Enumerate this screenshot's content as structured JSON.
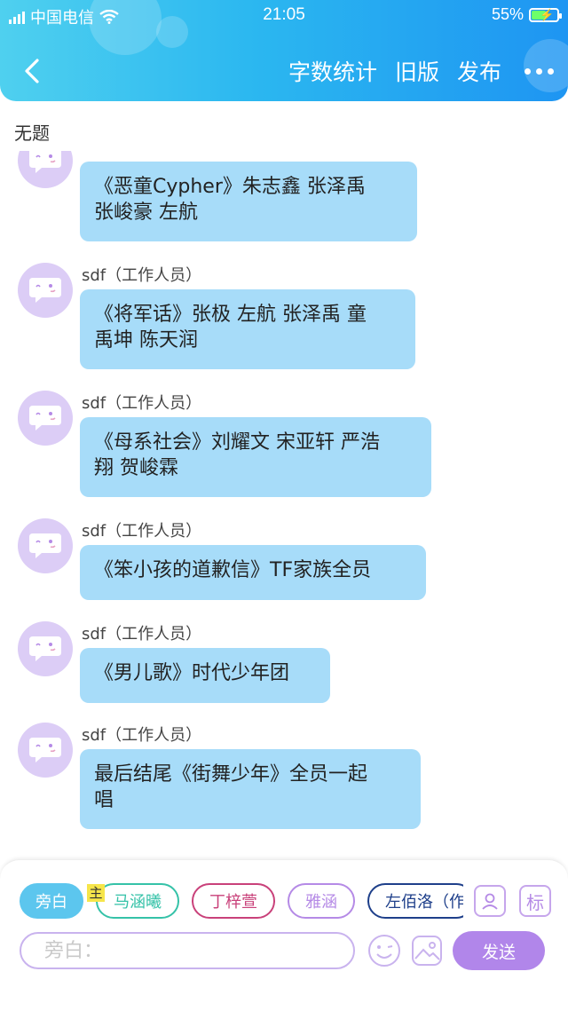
{
  "status_bar": {
    "carrier": "中国电信",
    "time": "21:05",
    "battery": "55%"
  },
  "nav": {
    "actions": [
      "字数统计",
      "旧版",
      "发布"
    ]
  },
  "subtitle": "无题",
  "messages": [
    {
      "sender": "",
      "text": "《恶童Cypher》朱志鑫 张泽禹\n张峻豪 左航"
    },
    {
      "sender": "sdf（工作人员）",
      "text": "《将军话》张极 左航 张泽禹 童\n禹坤 陈天润"
    },
    {
      "sender": "sdf（工作人员）",
      "text": "《母系社会》刘耀文 宋亚轩 严浩\n翔 贺峻霖"
    },
    {
      "sender": "sdf（工作人员）",
      "text": "《笨小孩的道歉信》TF家族全员"
    },
    {
      "sender": "sdf（工作人员）",
      "text": "《男儿歌》时代少年团"
    },
    {
      "sender": "sdf（工作人员）",
      "text": "最后结尾《街舞少年》全员一起\n唱"
    }
  ],
  "chips": [
    {
      "label": "旁白",
      "color": "#5cc6ee"
    },
    {
      "label": "马涵曦",
      "color": "#35c2a8"
    },
    {
      "label": "丁梓萱",
      "color": "#c9417a"
    },
    {
      "label": "雅涵",
      "color": "#b58ae6"
    },
    {
      "label": "左佰洛（作",
      "color": "#1e3f8a"
    }
  ],
  "host_badge": "主",
  "tag_button": "标",
  "input": {
    "placeholder": "旁白："
  },
  "send_label": "发送",
  "colors": {
    "header_start": "#4fd0ef",
    "header_end": "#1e95f2",
    "bubble": "#a7dcf9",
    "avatar": "#dccdf6",
    "accent_purple": "#b186ea"
  }
}
